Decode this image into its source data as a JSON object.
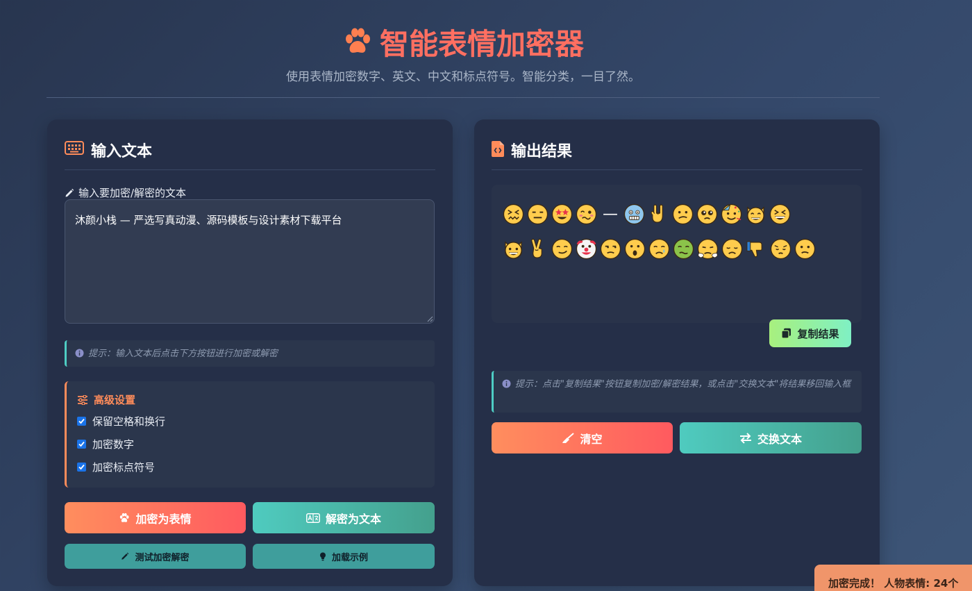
{
  "header": {
    "title": "智能表情加密器",
    "subtitle": "使用表情加密数字、英文、中文和标点符号。智能分类，一目了然。"
  },
  "input_panel": {
    "title": "输入文本",
    "field_label": "输入要加密/解密的文本",
    "textarea_value": "沐颜小栈 — 严选写真动漫、源码模板与设计素材下载平台",
    "hint": "提示：输入文本后点击下方按钮进行加密或解密",
    "settings": {
      "title": "高级设置",
      "options": [
        {
          "label": "保留空格和换行",
          "checked": true
        },
        {
          "label": "加密数字",
          "checked": true
        },
        {
          "label": "加密标点符号",
          "checked": true
        }
      ]
    },
    "buttons": {
      "encrypt": "加密为表情",
      "decrypt": "解密为文本",
      "test": "测试加密解密",
      "load_example": "加载示例"
    }
  },
  "output_panel": {
    "title": "输出结果",
    "emoji_output": {
      "line1": [
        "confounded-face",
        "expressionless-face",
        "star-struck-face",
        "woozy-face",
        "em-dash",
        "cold-face",
        "sign-of-horns",
        "confused-face",
        "pleading-face",
        "partying-face",
        "smiling-cat",
        "squinting-face"
      ],
      "line2": [
        "grinning-cat",
        "victory-hand",
        "smirking-face",
        "clown-face",
        "unamused-face",
        "hushed-face",
        "crying-face",
        "nauseated-face",
        "steam-face",
        "disappointed-face",
        "thumbs-down",
        "pensive-face",
        "slightly-confused-face"
      ],
      "dash_text": "—"
    },
    "copy_button": "复制结果",
    "hint": "提示：点击\"复制结果\"按钮复制加密/解密结果，或点击\"交换文本\"将结果移回输入框",
    "buttons": {
      "clear": "清空",
      "swap": "交换文本"
    }
  },
  "toast": {
    "text": "加密完成！ 人物表情: 24个"
  },
  "colors": {
    "accent_orange": "#ff6f61",
    "accent_teal": "#4ecdc4",
    "panel_bg": "#252f48"
  }
}
